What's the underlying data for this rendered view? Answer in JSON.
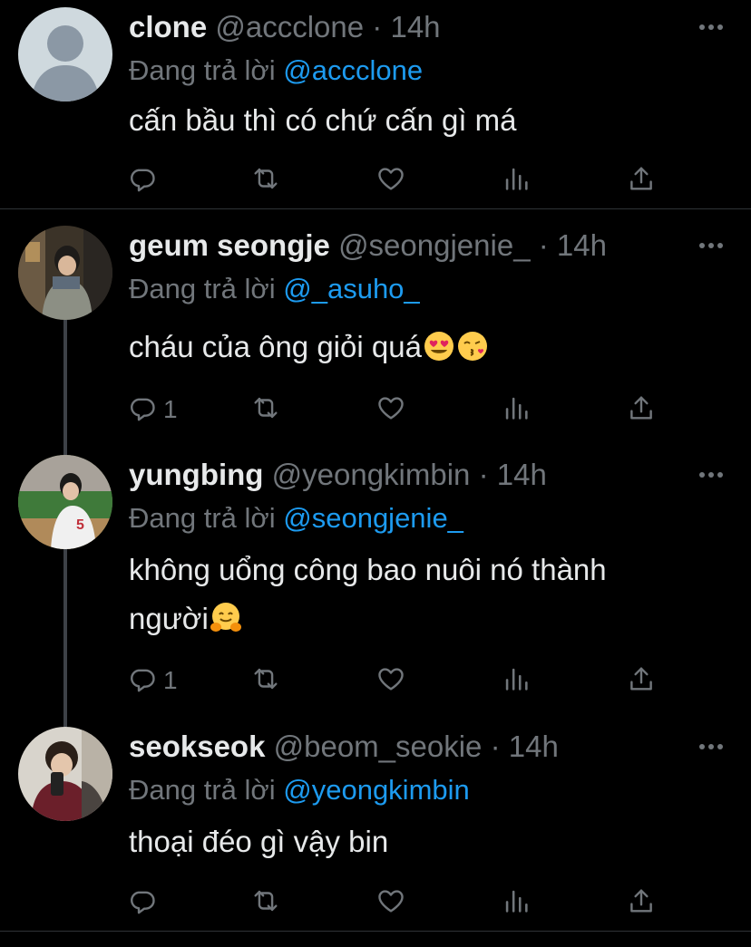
{
  "colors": {
    "background": "#000000",
    "text": "#e7e9ea",
    "secondary": "#71767b",
    "link": "#1d9bf0",
    "divider": "#2f3336"
  },
  "replying_label": "Đang trả lời",
  "tweets": [
    {
      "name": "clone",
      "handle": "@accclone",
      "separator": "·",
      "time": "14h",
      "reply_to": "@accclone",
      "text": "cấn bầu thì có chứ cấn gì má",
      "reply_count": ""
    },
    {
      "name": "geum seongje",
      "handle": "@seongjenie_",
      "separator": "·",
      "time": "14h",
      "reply_to": "@_asuho_",
      "text": "cháu của ông giỏi quá",
      "emojis": [
        "heart-eyes-emoji",
        "kissing-heart-emoji"
      ],
      "reply_count": "1"
    },
    {
      "name": "yungbing",
      "handle": "@yeongkimbin",
      "separator": "·",
      "time": "14h",
      "reply_to": "@seongjenie_",
      "text_line1": "không uổng công bao nuôi nó thành",
      "text_line2": "người",
      "emojis": [
        "hugging-face-emoji"
      ],
      "reply_count": "1"
    },
    {
      "name": "seokseok",
      "handle": "@beom_seokie",
      "separator": "·",
      "time": "14h",
      "reply_to": "@yeongkimbin",
      "text": "thoại đéo gì vậy bin",
      "reply_count": ""
    }
  ]
}
